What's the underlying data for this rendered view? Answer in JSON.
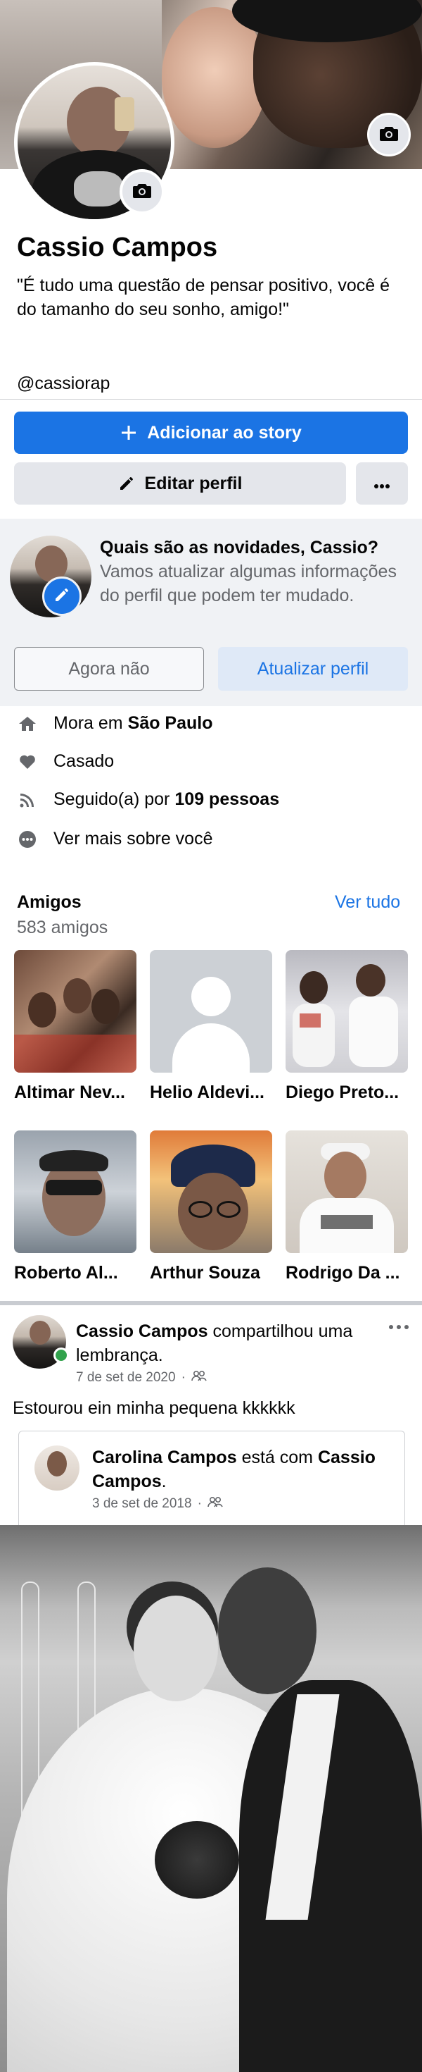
{
  "profile": {
    "name": "Cassio Campos",
    "bio": "\"É tudo uma questão de pensar positivo, você é do tamanho do seu sonho, amigo!\"",
    "handle": "@cassiorap"
  },
  "actions": {
    "add_story": "Adicionar ao story",
    "edit_profile": "Editar perfil"
  },
  "update_card": {
    "title": "Quais são as novidades, Cassio?",
    "text": "Vamos atualizar algumas informações do perfil que podem ter mudado.",
    "not_now": "Agora não",
    "update": "Atualizar perfil"
  },
  "details": {
    "lives_prefix": "Mora em",
    "lives_city": "São Paulo",
    "relationship": "Casado",
    "followers_prefix": "Seguido(a) por",
    "followers_count": "109 pessoas",
    "see_more": "Ver mais sobre você"
  },
  "friends": {
    "title": "Amigos",
    "count": "583 amigos",
    "see_all": "Ver tudo",
    "items": [
      {
        "name": "Altimar Nev..."
      },
      {
        "name": "Helio Aldevi..."
      },
      {
        "name": "Diego Preto..."
      },
      {
        "name": "Roberto Al..."
      },
      {
        "name": "Arthur Souza"
      },
      {
        "name": "Rodrigo Da ..."
      }
    ]
  },
  "post": {
    "author": "Cassio Campos",
    "action": "compartilhou uma lembrança.",
    "date": "7 de set de 2020",
    "text": "Estourou ein minha pequena kkkkkk",
    "shared": {
      "author": "Carolina Campos",
      "with": "está com",
      "tagged": "Cassio Campos",
      "date": "3 de set de 2018"
    }
  },
  "colors": {
    "accent": "#1b74e4",
    "online": "#31a24c",
    "secondary_text": "#65676b"
  },
  "icons": {
    "cover_camera": "camera-icon",
    "avatar_camera": "camera-icon",
    "add": "plus-icon",
    "edit": "pencil-icon",
    "more": "more-horizontal-icon",
    "home": "home-icon",
    "heart": "heart-icon",
    "rss": "rss-icon",
    "ellipsis_circle": "more-circle-icon",
    "friends_privacy": "friends-icon"
  }
}
